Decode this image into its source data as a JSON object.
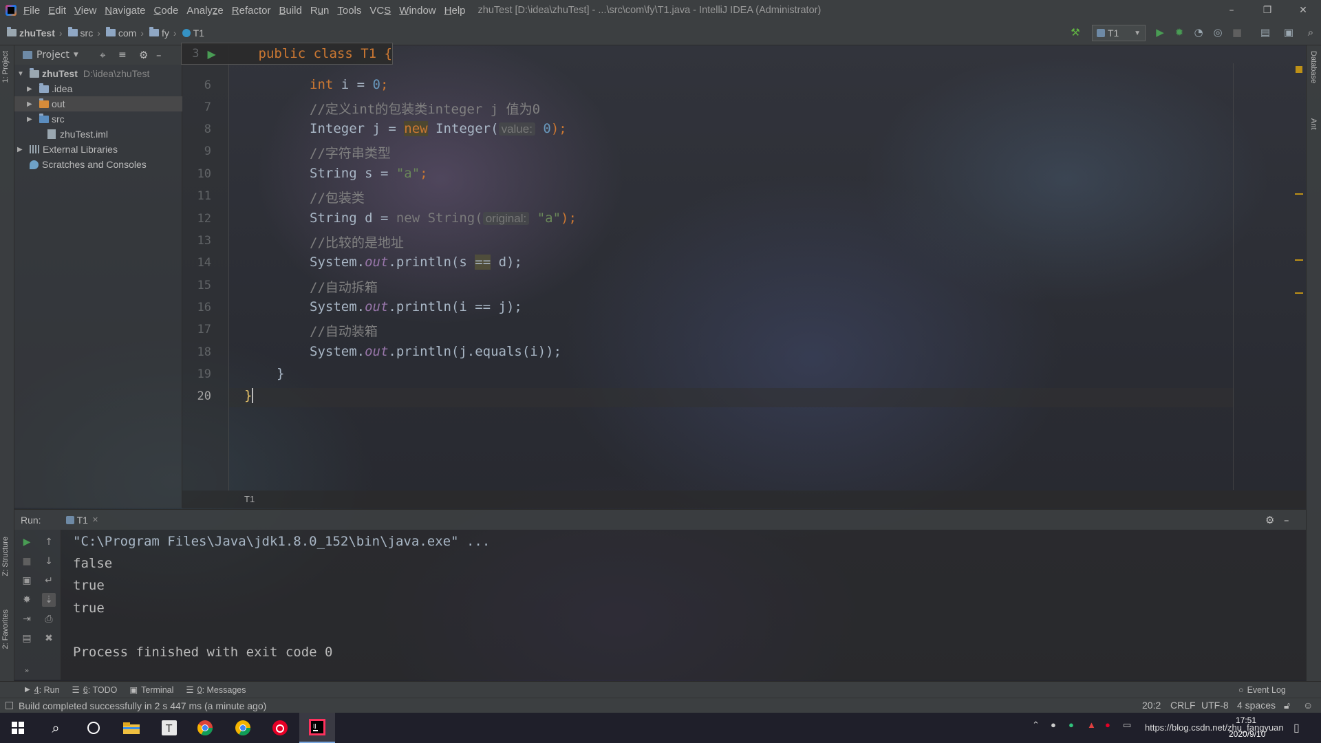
{
  "title_bar": {
    "menu": [
      {
        "pre": "",
        "u": "F",
        "post": "ile"
      },
      {
        "pre": "",
        "u": "E",
        "post": "dit"
      },
      {
        "pre": "",
        "u": "V",
        "post": "iew"
      },
      {
        "pre": "",
        "u": "N",
        "post": "avigate"
      },
      {
        "pre": "",
        "u": "C",
        "post": "ode"
      },
      {
        "pre": "Analy",
        "u": "z",
        "post": "e"
      },
      {
        "pre": "",
        "u": "R",
        "post": "efactor"
      },
      {
        "pre": "",
        "u": "B",
        "post": "uild"
      },
      {
        "pre": "R",
        "u": "u",
        "post": "n"
      },
      {
        "pre": "",
        "u": "T",
        "post": "ools"
      },
      {
        "pre": "VC",
        "u": "S",
        "post": ""
      },
      {
        "pre": "",
        "u": "W",
        "post": "indow"
      },
      {
        "pre": "",
        "u": "H",
        "post": "elp"
      }
    ],
    "window_title": "zhuTest [D:\\idea\\zhuTest] - ...\\src\\com\\fy\\T1.java - IntelliJ IDEA (Administrator)"
  },
  "breadcrumbs": [
    "zhuTest",
    "src",
    "com",
    "fy",
    "T1"
  ],
  "run_config": "T1",
  "project_panel": {
    "title": "Project",
    "tree": [
      {
        "name": "zhuTest",
        "path": "D:\\idea\\zhuTest",
        "kind": "project",
        "expanded": true
      },
      {
        "name": ".idea",
        "kind": "folder",
        "expanded": false
      },
      {
        "name": "out",
        "kind": "folder-excluded",
        "expanded": false
      },
      {
        "name": "src",
        "kind": "folder-source",
        "expanded": false
      },
      {
        "name": "zhuTest.iml",
        "kind": "file"
      },
      {
        "name": "External Libraries",
        "kind": "library",
        "expanded": false
      },
      {
        "name": "Scratches and Consoles",
        "kind": "scratch"
      }
    ]
  },
  "left_stripe_tabs": [
    "1: Project",
    "Z: Structure",
    "2: Favorites"
  ],
  "right_stripe_tabs": [
    "Database",
    "Ant"
  ],
  "editor": {
    "sticky_line_number": "3",
    "sticky_code": "public class T1 {",
    "line_numbers": [
      "6",
      "7",
      "8",
      "9",
      "10",
      "11",
      "12",
      "13",
      "14",
      "15",
      "16",
      "17",
      "18",
      "19",
      "20"
    ],
    "lines": {
      "l6_type": "int",
      "l6_rest": " i = ",
      "l6_num": "0",
      "l6_end": ";",
      "l7": "//定义int的包装类integer j 值为0",
      "l8_a": "Integer j = ",
      "l8_new": "new",
      "l8_b": " Integer(",
      "l8_hint": "value:",
      "l8_num": "0",
      "l8_end": ");",
      "l9": "//字符串类型",
      "l10_a": "String s = ",
      "l10_str": "\"a\"",
      "l10_end": ";",
      "l11": "//包装类",
      "l12_a": "String d = ",
      "l12_new": "new String(",
      "l12_hint": "original:",
      "l12_str": "\"a\"",
      "l12_end": ");",
      "l13": "//比较的是地址",
      "l14_a": "System.",
      "l14_out": "out",
      "l14_b": ".println(s ",
      "l14_eq": "==",
      "l14_c": " d);",
      "l15": "//自动拆箱",
      "l16_a": "System.",
      "l16_out": "out",
      "l16_b": ".println(i == j);",
      "l17": "//自动装箱",
      "l18_a": "System.",
      "l18_out": "out",
      "l18_b": ".println(j.equals(i));",
      "l19": "}",
      "l20": "}"
    },
    "footer_breadcrumb": "T1"
  },
  "run_panel": {
    "label": "Run:",
    "tab": "T1",
    "output": [
      "\"C:\\Program Files\\Java\\jdk1.8.0_152\\bin\\java.exe\" ...",
      "false",
      "true",
      "true",
      "",
      "Process finished with exit code 0"
    ]
  },
  "tool_tabs": [
    {
      "u": "4",
      "rest": ": Run"
    },
    {
      "u": "6",
      "rest": ": TODO"
    },
    {
      "u": "",
      "rest": "Terminal"
    },
    {
      "u": "0",
      "rest": ": Messages"
    }
  ],
  "event_log": "Event Log",
  "status_bar": {
    "message": "Build completed successfully in 2 s 447 ms (a minute ago)",
    "position": "20:2",
    "line_sep": "CRLF",
    "encoding": "UTF-8",
    "indent": "4 spaces"
  },
  "taskbar": {
    "watermark": "https://blog.csdn.net/zhu_fangyuan",
    "time": "17:51",
    "date": "2020/9/10"
  },
  "colors": {
    "keyword": "#cc7832",
    "number": "#6897bb",
    "string": "#6a8759",
    "comment": "#808080",
    "field": "#9876aa",
    "run_green": "#499c54"
  }
}
